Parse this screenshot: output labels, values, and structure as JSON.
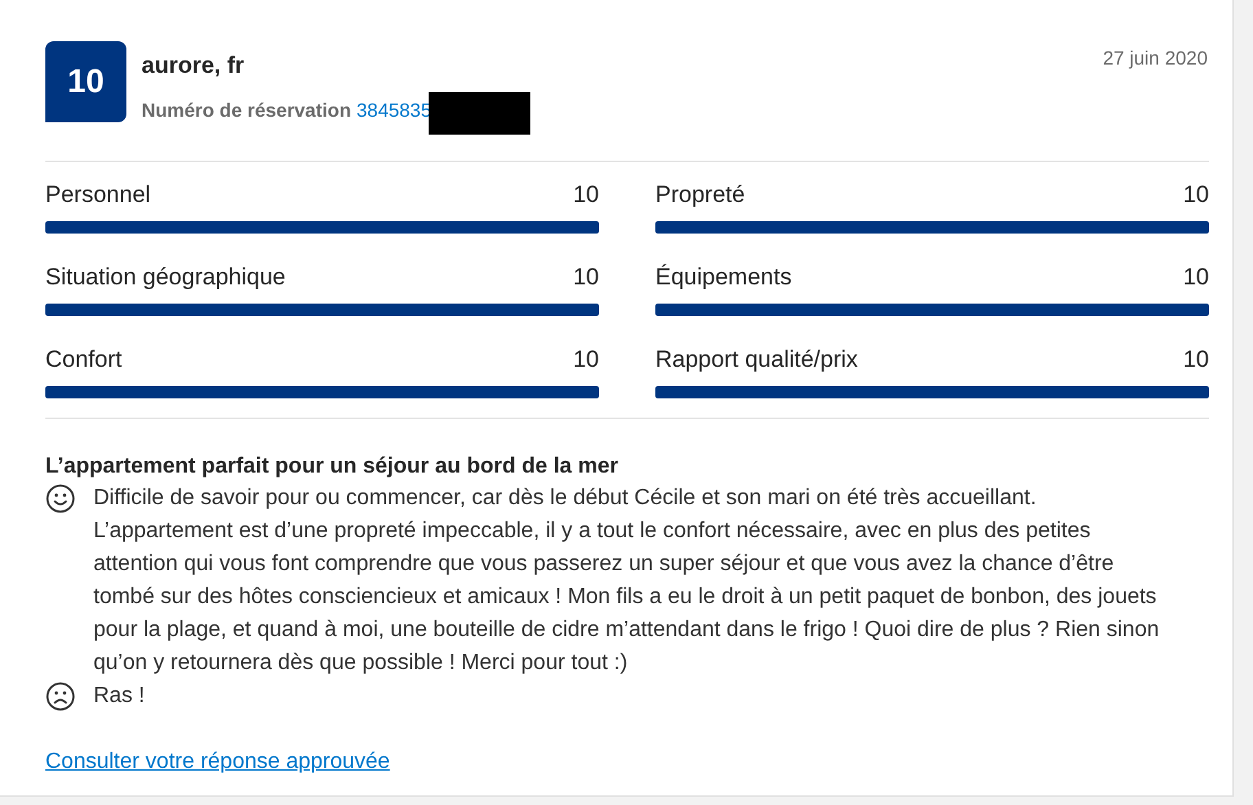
{
  "review": {
    "score": "10",
    "reviewer": "aurore, fr",
    "booking_label": "Numéro de réservation",
    "booking_number": "3845835",
    "redacted": true,
    "date": "27 juin 2020",
    "categories": [
      {
        "label": "Personnel",
        "score": "10",
        "level": 1
      },
      {
        "label": "Propreté",
        "score": "10",
        "level": 1
      },
      {
        "label": "Situation géographique",
        "score": "10",
        "level": 1
      },
      {
        "label": "Équipements",
        "score": "10",
        "level": 1
      },
      {
        "label": "Confort",
        "score": "10",
        "level": 1
      },
      {
        "label": "Rapport qualité/prix",
        "score": "10",
        "level": 1
      }
    ],
    "title": "L’appartement parfait pour un séjour au bord de la mer",
    "comments": [
      {
        "kind": "positive",
        "text": "Difficile de savoir pour ou commencer, car dès le début Cécile et son mari on été très accueillant. L’appartement est d’une propreté impeccable, il y a tout le confort nécessaire, avec en plus des petites attention qui vous font comprendre que vous passerez un super séjour et que vous avez la chance d’être tombé sur des hôtes consciencieux et amicaux ! Mon fils a eu le droit à un petit paquet de bonbon, des jouets pour la plage, et quand à moi, une bouteille de cidre m’attendant dans le frigo ! Quoi dire de plus ? Rien sinon qu’on y retournera dès que possible ! Merci pour tout :)"
      },
      {
        "kind": "negative",
        "text": "Ras !"
      }
    ],
    "link": "Consulter votre réponse approuvée"
  }
}
